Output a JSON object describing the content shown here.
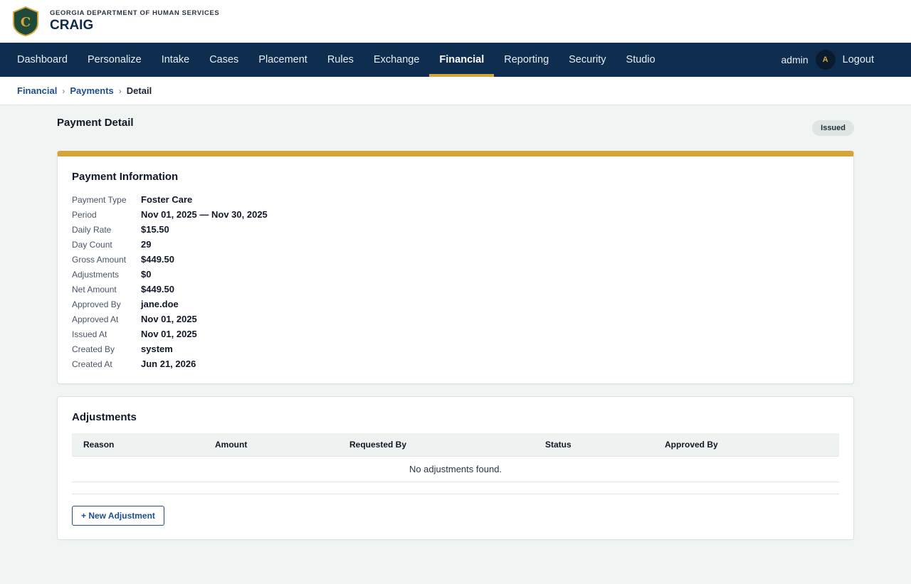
{
  "header": {
    "agency": "GEORGIA DEPARTMENT OF HUMAN SERVICES",
    "app_name": "CRAIG",
    "logo_letter": "C"
  },
  "nav": {
    "items": [
      {
        "label": "Dashboard",
        "active": false
      },
      {
        "label": "Personalize",
        "active": false
      },
      {
        "label": "Intake",
        "active": false
      },
      {
        "label": "Cases",
        "active": false
      },
      {
        "label": "Placement",
        "active": false
      },
      {
        "label": "Rules",
        "active": false
      },
      {
        "label": "Exchange",
        "active": false
      },
      {
        "label": "Financial",
        "active": true
      },
      {
        "label": "Reporting",
        "active": false
      },
      {
        "label": "Security",
        "active": false
      },
      {
        "label": "Studio",
        "active": false
      }
    ],
    "user": "admin",
    "avatar_letter": "A",
    "logout": "Logout"
  },
  "breadcrumb": {
    "items": [
      "Financial",
      "Payments"
    ],
    "current": "Detail",
    "separator": "›"
  },
  "page": {
    "title": "Payment Detail",
    "status": "Issued"
  },
  "payment_info": {
    "title": "Payment Information",
    "fields": [
      {
        "label": "Payment Type",
        "value": "Foster Care"
      },
      {
        "label": "Period",
        "value": "Nov 01, 2025 — Nov 30, 2025"
      },
      {
        "label": "Daily Rate",
        "value": "$15.50"
      },
      {
        "label": "Day Count",
        "value": "29"
      },
      {
        "label": "Gross Amount",
        "value": "$449.50"
      },
      {
        "label": "Adjustments",
        "value": "$0"
      },
      {
        "label": "Net Amount",
        "value": "$449.50"
      },
      {
        "label": "Approved By",
        "value": "jane.doe"
      },
      {
        "label": "Approved At",
        "value": "Nov 01, 2025"
      },
      {
        "label": "Issued At",
        "value": "Nov 01, 2025"
      },
      {
        "label": "Created By",
        "value": "system"
      },
      {
        "label": "Created At",
        "value": "Jun 21, 2026"
      }
    ]
  },
  "adjustments": {
    "title": "Adjustments",
    "columns": [
      "Reason",
      "Amount",
      "Requested By",
      "Status",
      "Approved By"
    ],
    "empty_message": "No adjustments found.",
    "new_button": "+ New Adjustment"
  },
  "colors": {
    "navy": "#0f2d4e",
    "gold": "#d4a63a",
    "link": "#1e4e8c",
    "page_bg": "#f0f4f2"
  }
}
